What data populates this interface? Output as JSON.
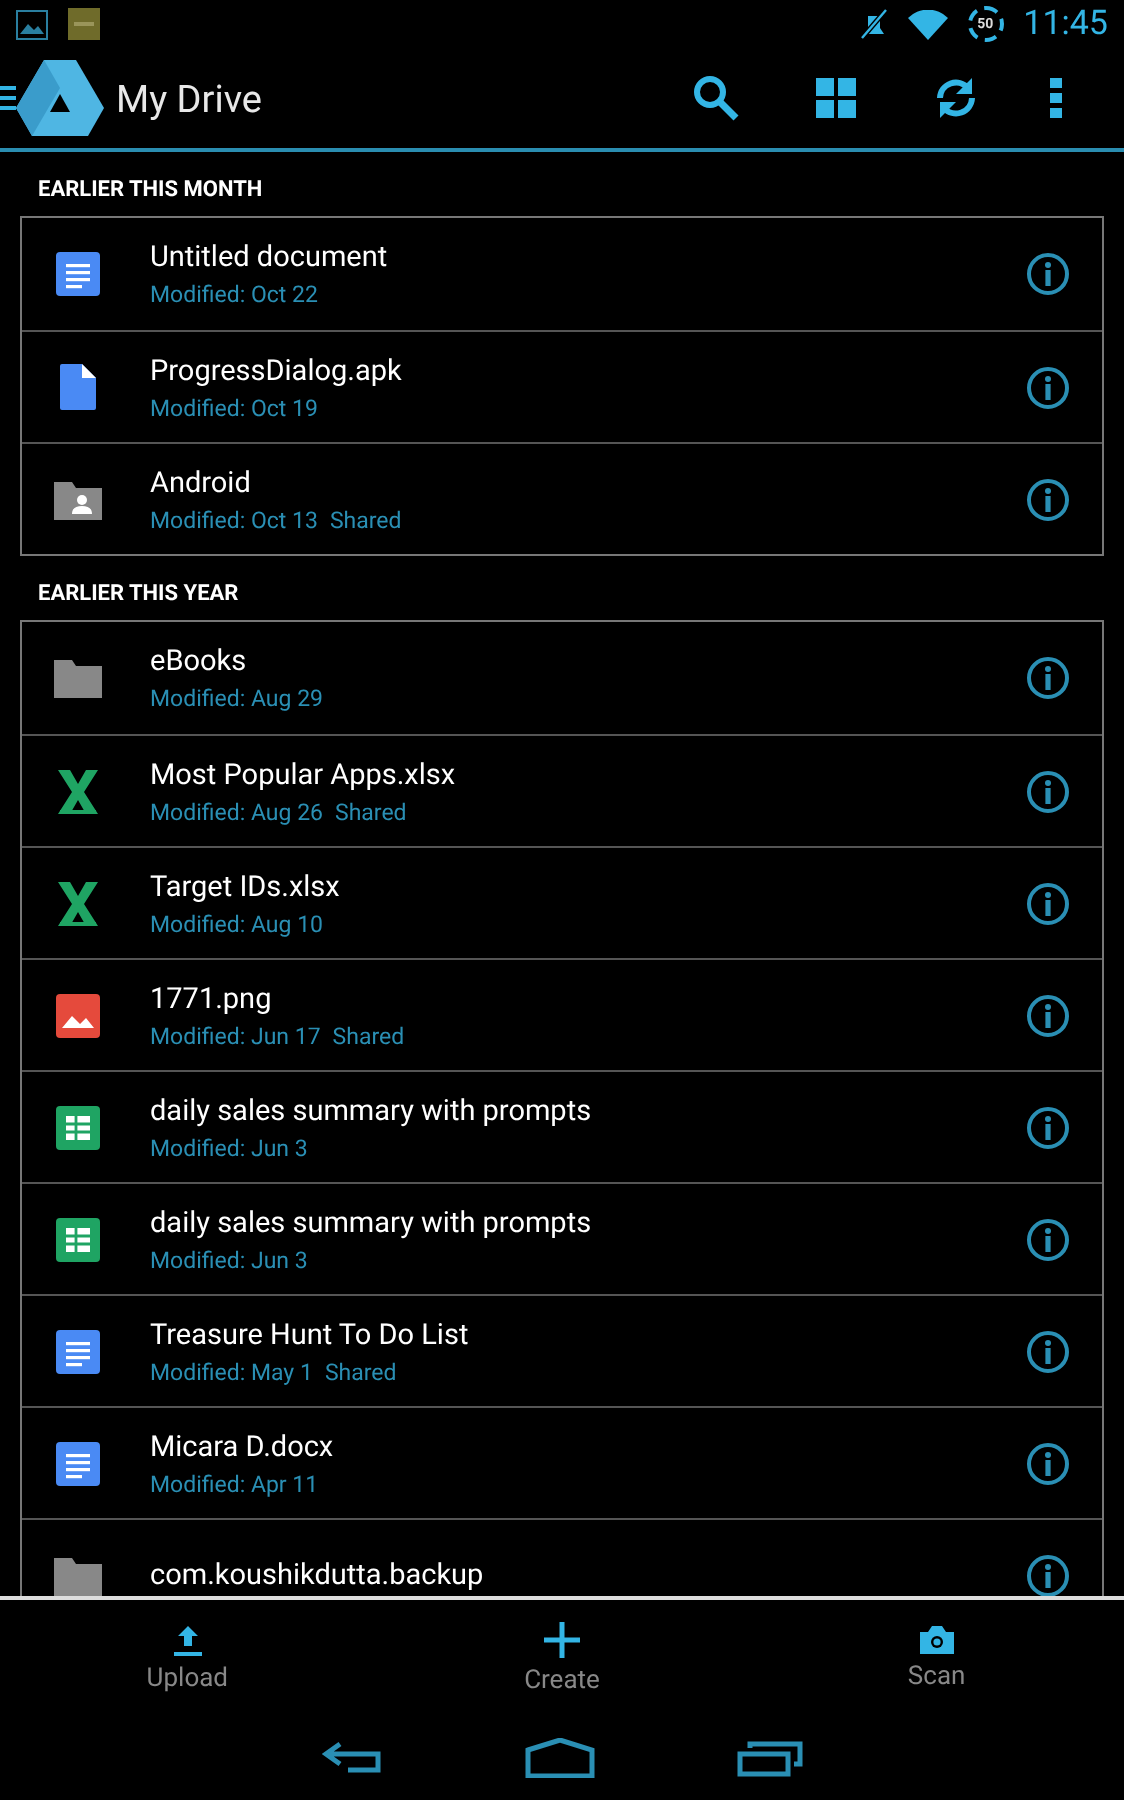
{
  "status_bar": {
    "time": "11:45",
    "battery": "50"
  },
  "action_bar": {
    "title": "My Drive"
  },
  "sections": [
    {
      "title": "EARLIER THIS MONTH",
      "items": [
        {
          "kind": "doc",
          "name": "Untitled document",
          "modified": "Modified: Oct 22"
        },
        {
          "kind": "file",
          "name": "ProgressDialog.apk",
          "modified": "Modified: Oct 19"
        },
        {
          "kind": "shared-folder",
          "name": "Android",
          "modified": "Modified: Oct 13",
          "shared": "Shared"
        }
      ]
    },
    {
      "title": "EARLIER THIS YEAR",
      "items": [
        {
          "kind": "folder",
          "name": "eBooks",
          "modified": "Modified: Aug 29"
        },
        {
          "kind": "excel",
          "name": "Most Popular Apps.xlsx",
          "modified": "Modified: Aug 26",
          "shared": "Shared"
        },
        {
          "kind": "excel",
          "name": "Target IDs.xlsx",
          "modified": "Modified: Aug 10"
        },
        {
          "kind": "image",
          "name": "1771.png",
          "modified": "Modified: Jun 17",
          "shared": "Shared"
        },
        {
          "kind": "sheet",
          "name": "daily sales summary with prompts",
          "modified": "Modified: Jun 3"
        },
        {
          "kind": "sheet",
          "name": "daily sales summary with prompts",
          "modified": "Modified: Jun 3"
        },
        {
          "kind": "doc",
          "name": "Treasure Hunt To Do List",
          "modified": "Modified: May 1",
          "shared": "Shared"
        },
        {
          "kind": "doc",
          "name": "Micara D.docx",
          "modified": "Modified: Apr 11"
        },
        {
          "kind": "folder",
          "name": "com.koushikdutta.backup"
        }
      ]
    }
  ],
  "bottom_actions": [
    {
      "kind": "upload",
      "label": "Upload"
    },
    {
      "kind": "create",
      "label": "Create"
    },
    {
      "kind": "scan",
      "label": "Scan"
    }
  ]
}
